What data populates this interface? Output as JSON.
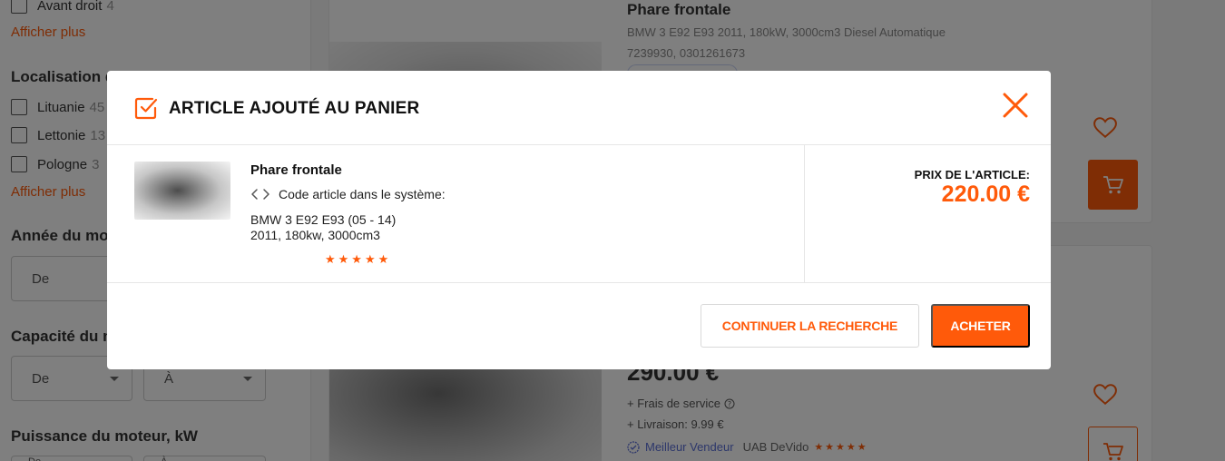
{
  "sidebar": {
    "top_option": {
      "label": "Avant droit",
      "count": "4"
    },
    "show_more_1": "Afficher plus",
    "location_title": "Localisation du vend",
    "locations": [
      {
        "label": "Lituanie",
        "count": "45"
      },
      {
        "label": "Lettonie",
        "count": "13"
      },
      {
        "label": "Pologne",
        "count": "3"
      }
    ],
    "show_more_2": "Afficher plus",
    "year_title": "Année du mo",
    "year_from": "De",
    "capacity_title": "Capacité du m",
    "capacity_from": "De",
    "capacity_to": "À",
    "power_title": "Puissance du moteur, kW",
    "power_from": "De",
    "power_to": "À"
  },
  "listing": {
    "item1": {
      "title": "Phare frontale",
      "subtitle": "BMW 3 E92 E93 2011, 180kW, 3000cm3 Diesel Automatique",
      "codes": "7239930, 0301261673"
    },
    "item2": {
      "price": "290.00 €",
      "service_fee": "+ Frais de service",
      "delivery": "+ Livraison: 9.99 €",
      "seller_badge": "Meilleur Vendeur",
      "seller_name": "UAB DeVido",
      "stars": "★★★★★"
    }
  },
  "modal": {
    "title": "ARTICLE AJOUTÉ AU PANIER",
    "product_name": "Phare frontale",
    "code_label": "Code article dans le système:",
    "car_line1": "BMW 3 E92 E93 (05 - 14)",
    "car_line2": "2011, 180kw, 3000cm3",
    "stars": "★★★★★",
    "price_label": "PRIX DE L'ARTICLE:",
    "price": "220.00 €",
    "continue_label": "CONTINUER LA RECHERCHE",
    "buy_label": "ACHETER"
  },
  "colors": {
    "accent": "#ff5a0a",
    "overlay": "rgba(0,0,0,0.5)",
    "seller_blue": "#5a6fd6"
  },
  "icons": [
    "checkbox-checked-icon",
    "close-icon",
    "code-brackets-icon",
    "star-icon",
    "heart-icon",
    "cart-icon",
    "info-icon",
    "verified-badge-icon"
  ]
}
